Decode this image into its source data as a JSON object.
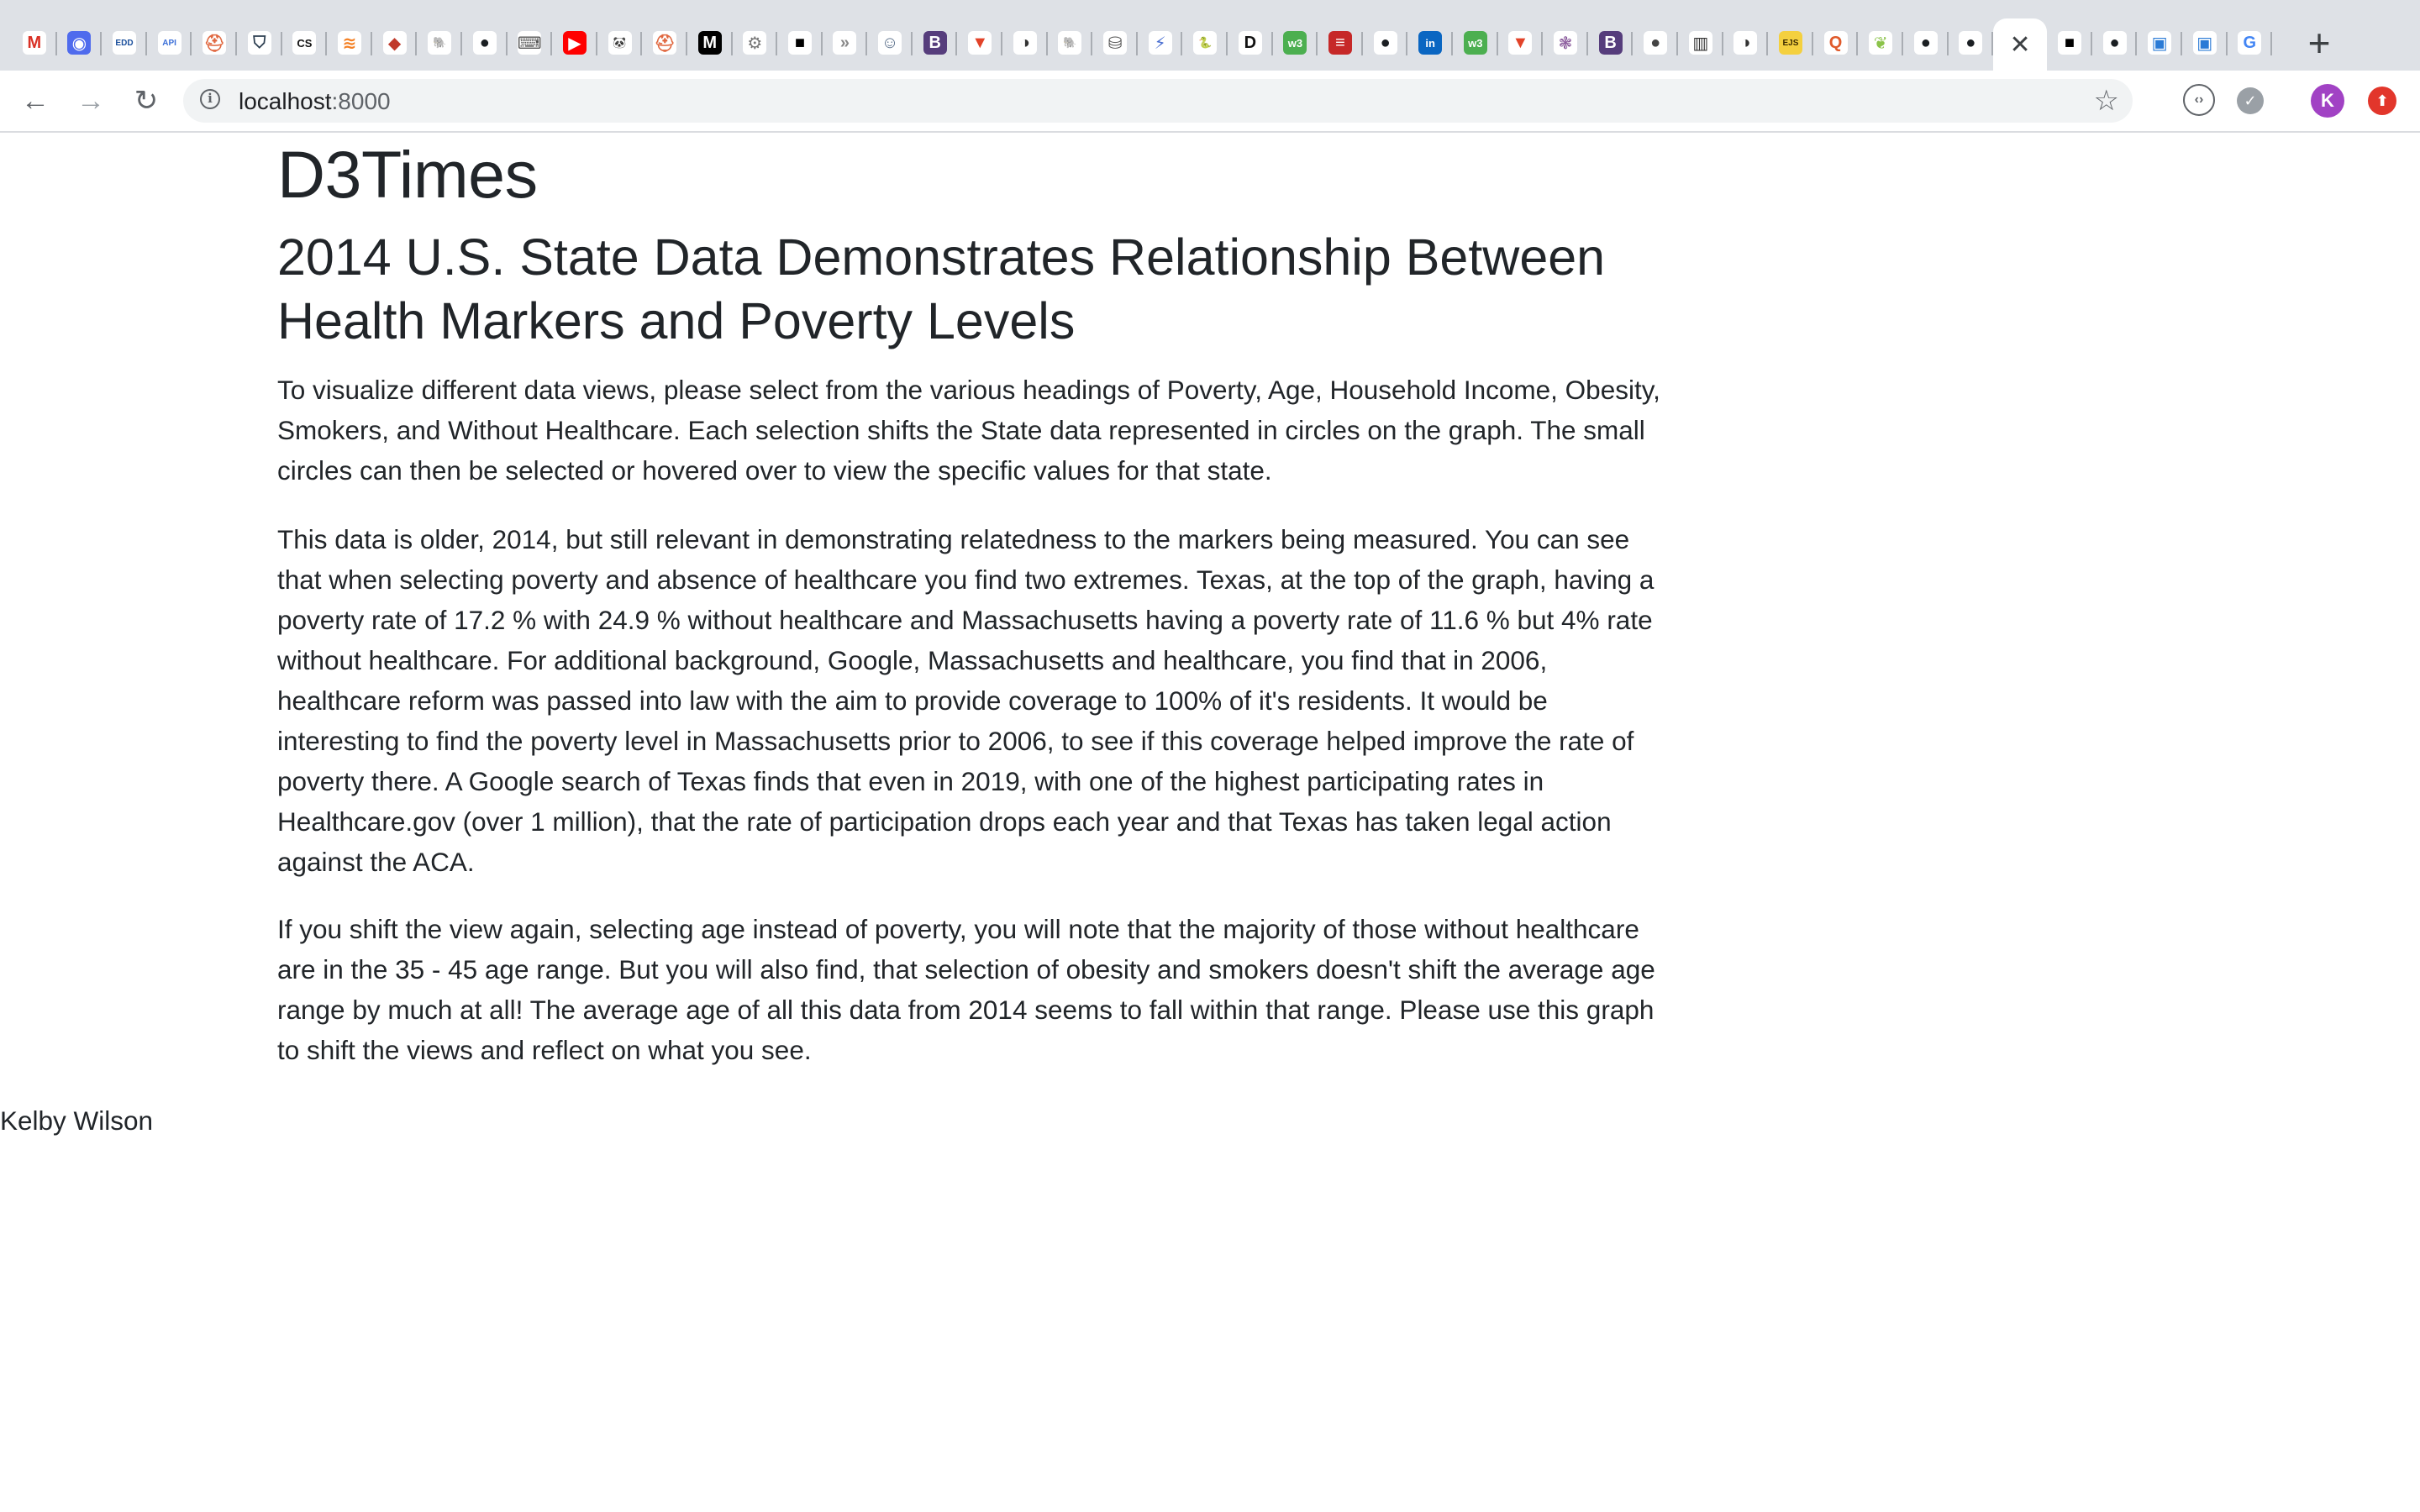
{
  "browser": {
    "active_tab_close": "✕",
    "new_tab": "+",
    "url_host": "localhost",
    "url_port": ":8000",
    "profile_initial": "K",
    "tab_icons": [
      {
        "name": "gmail-icon",
        "glyph": "M",
        "bg": "#ffffff",
        "fg": "#d93025"
      },
      {
        "name": "circle-app-icon",
        "glyph": "◉",
        "bg": "#4f6bed",
        "fg": "#ffffff"
      },
      {
        "name": "edd-icon",
        "glyph": "EDD",
        "bg": "#ffffff",
        "fg": "#1a4f9c"
      },
      {
        "name": "api-icon",
        "glyph": "API",
        "bg": "#ffffff",
        "fg": "#3b6fd8"
      },
      {
        "name": "helmet-icon",
        "glyph": "⛑",
        "bg": "#ffffff",
        "fg": "#e0673f"
      },
      {
        "name": "shield-icon",
        "glyph": "⛉",
        "bg": "#ffffff",
        "fg": "#2c3e50"
      },
      {
        "name": "cs-icon",
        "glyph": "CS",
        "bg": "#ffffff",
        "fg": "#111111"
      },
      {
        "name": "stack-icon",
        "glyph": "≋",
        "bg": "#ffffff",
        "fg": "#f48024"
      },
      {
        "name": "diamond-icon",
        "glyph": "◆",
        "bg": "#ffffff",
        "fg": "#c0392b"
      },
      {
        "name": "postgres-icon",
        "glyph": "🐘",
        "bg": "#ffffff",
        "fg": "#336791"
      },
      {
        "name": "github-icon",
        "glyph": "●",
        "bg": "#ffffff",
        "fg": "#1b1f23"
      },
      {
        "name": "terminal-icon",
        "glyph": "⌨",
        "bg": "#ffffff",
        "fg": "#555555"
      },
      {
        "name": "youtube-icon",
        "glyph": "▶",
        "bg": "#ff0000",
        "fg": "#ffffff"
      },
      {
        "name": "panda-icon",
        "glyph": "🐼",
        "bg": "#ffffff",
        "fg": "#111111"
      },
      {
        "name": "helmet-icon-2",
        "glyph": "⛑",
        "bg": "#ffffff",
        "fg": "#e0673f"
      },
      {
        "name": "medium-icon",
        "glyph": "M",
        "bg": "#000000",
        "fg": "#ffffff"
      },
      {
        "name": "gear-icon",
        "glyph": "⚙",
        "bg": "#ffffff",
        "fg": "#777777"
      },
      {
        "name": "black-square-icon",
        "glyph": "■",
        "bg": "#ffffff",
        "fg": "#000000"
      },
      {
        "name": "chevron-double-icon",
        "glyph": "»",
        "bg": "#ffffff",
        "fg": "#888888"
      },
      {
        "name": "robot-icon",
        "glyph": "☺",
        "bg": "#ffffff",
        "fg": "#5a6f8a"
      },
      {
        "name": "bootstrap-icon",
        "glyph": "B",
        "bg": "#563d7c",
        "fg": "#ffffff"
      },
      {
        "name": "gitlab-icon",
        "glyph": "▼",
        "bg": "#ffffff",
        "fg": "#e24329"
      },
      {
        "name": "globe-icon",
        "glyph": "◑",
        "bg": "#ffffff",
        "fg": "#333333"
      },
      {
        "name": "postgres-icon-2",
        "glyph": "🐘",
        "bg": "#ffffff",
        "fg": "#336791"
      },
      {
        "name": "database-icon",
        "glyph": "⛁",
        "bg": "#ffffff",
        "fg": "#555555"
      },
      {
        "name": "bolt-icon",
        "glyph": "⚡",
        "bg": "#ffffff",
        "fg": "#4a6fd1"
      },
      {
        "name": "python-icon",
        "glyph": "🐍",
        "bg": "#ffffff",
        "fg": "#3776ab"
      },
      {
        "name": "d3-icon",
        "glyph": "D",
        "bg": "#ffffff",
        "fg": "#111111"
      },
      {
        "name": "w3-icon",
        "glyph": "w3",
        "bg": "#4caf50",
        "fg": "#ffffff"
      },
      {
        "name": "red-stripes-icon",
        "glyph": "≡",
        "bg": "#c62828",
        "fg": "#ffffff"
      },
      {
        "name": "github-icon-2",
        "glyph": "●",
        "bg": "#ffffff",
        "fg": "#1b1f23"
      },
      {
        "name": "linkedin-icon",
        "glyph": "in",
        "bg": "#0a66c2",
        "fg": "#ffffff"
      },
      {
        "name": "w3-icon-2",
        "glyph": "w3",
        "bg": "#4caf50",
        "fg": "#ffffff"
      },
      {
        "name": "gitlab-icon-2",
        "glyph": "▼",
        "bg": "#ffffff",
        "fg": "#e24329"
      },
      {
        "name": "brain-icon",
        "glyph": "❃",
        "bg": "#ffffff",
        "fg": "#8a5a9c"
      },
      {
        "name": "bootstrap-icon-2",
        "glyph": "B",
        "bg": "#563d7c",
        "fg": "#ffffff"
      },
      {
        "name": "dark-circle-icon",
        "glyph": "●",
        "bg": "#ffffff",
        "fg": "#444444"
      },
      {
        "name": "book-icon",
        "glyph": "▥",
        "bg": "#ffffff",
        "fg": "#333333"
      },
      {
        "name": "globe-icon-2",
        "glyph": "◑",
        "bg": "#ffffff",
        "fg": "#333333"
      },
      {
        "name": "ejs-icon",
        "glyph": "EJS",
        "bg": "#f4d03f",
        "fg": "#3a2a00"
      },
      {
        "name": "q-icon",
        "glyph": "Q",
        "bg": "#ffffff",
        "fg": "#e05a2b"
      },
      {
        "name": "leaf-icon",
        "glyph": "❦",
        "bg": "#ffffff",
        "fg": "#8bc34a"
      },
      {
        "name": "github-icon-3",
        "glyph": "●",
        "bg": "#ffffff",
        "fg": "#1b1f23"
      },
      {
        "name": "github-icon-4",
        "glyph": "●",
        "bg": "#ffffff",
        "fg": "#1b1f23"
      }
    ],
    "after_tab_icons": [
      {
        "name": "black-square-icon-2",
        "glyph": "■",
        "bg": "#ffffff",
        "fg": "#000000"
      },
      {
        "name": "github-icon-5",
        "glyph": "●",
        "bg": "#ffffff",
        "fg": "#1b1f23"
      },
      {
        "name": "doc-icon",
        "glyph": "▣",
        "bg": "#ffffff",
        "fg": "#2b7bd6"
      },
      {
        "name": "doc-icon-2",
        "glyph": "▣",
        "bg": "#ffffff",
        "fg": "#2b7bd6"
      },
      {
        "name": "google-icon",
        "glyph": "G",
        "bg": "#ffffff",
        "fg": "#4285f4"
      }
    ]
  },
  "page": {
    "site_title": "D3Times",
    "headline": "2014 U.S. State Data Demonstrates Relationship Between Health Markers and Poverty Levels",
    "paragraphs": [
      "To visualize different data views, please select from the various headings of Poverty, Age, Household Income, Obesity, Smokers, and Without Healthcare. Each selection shifts the State data represented in circles on the graph. The small circles can then be selected or hovered over to view the specific values for that state.",
      "This data is older, 2014, but still relevant in demonstrating relatedness to the markers being measured. You can see that when selecting poverty and absence of healthcare you find two extremes. Texas, at the top of the graph, having a poverty rate of 17.2 % with 24.9 % without healthcare and Massachusetts having a poverty rate of 11.6 % but 4% rate without healthcare. For additional background, Google, Massachusetts and healthcare, you find that in 2006, healthcare reform was passed into law with the aim to provide coverage to 100% of it's residents. It would be interesting to find the poverty level in Massachusetts prior to 2006, to see if this coverage helped improve the rate of poverty there. A Google search of Texas finds that even in 2019, with one of the highest participating rates in Healthcare.gov (over 1 million), that the rate of participation drops each year and that Texas has taken legal action against the ACA.",
      "If you shift the view again, selecting age instead of poverty, you will note that the majority of those without healthcare are in the 35 - 45 age range. But you will also find, that selection of obesity and smokers doesn't shift the average age range by much at all! The average age of all this data from 2014 seems to fall within that range. Please use this graph to shift the views and reflect on what you see."
    ],
    "footer_name": "Kelby Wilson"
  }
}
